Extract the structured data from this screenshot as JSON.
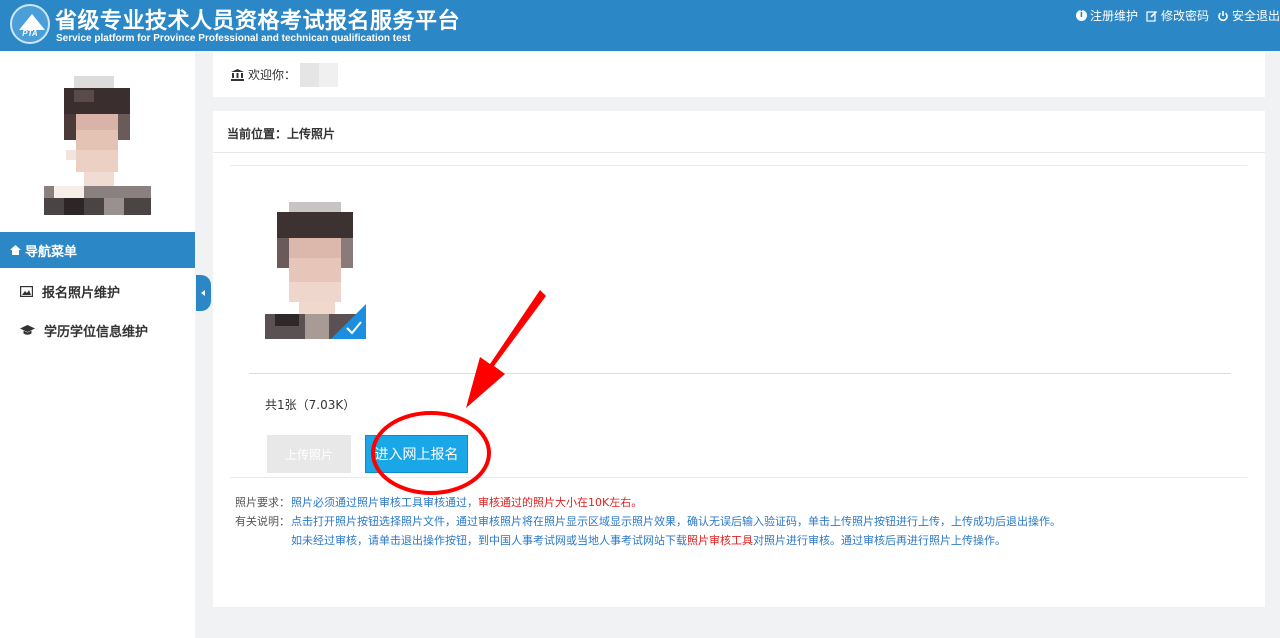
{
  "header": {
    "logo_text": "PTA",
    "title": "省级专业技术人员资格考试报名服务平台",
    "subtitle": "Service platform for Province Professional and technican qualification test",
    "links": [
      {
        "icon": "info-icon",
        "label": "注册维护"
      },
      {
        "icon": "edit-icon",
        "label": "修改密码"
      },
      {
        "icon": "power-icon",
        "label": "安全退出"
      }
    ]
  },
  "sidebar": {
    "nav_title": "导航菜单",
    "items": [
      {
        "icon": "image-icon",
        "label": "报名照片维护"
      },
      {
        "icon": "graduation-cap-icon",
        "label": "学历学位信息维护"
      }
    ]
  },
  "welcome": {
    "label": "欢迎你："
  },
  "main": {
    "breadcrumb": "当前位置：上传照片",
    "photo_count": "共1张（7.03K）",
    "upload_button": "上传照片",
    "enter_button": "进入网上报名",
    "notes": {
      "req_label": "照片要求：",
      "req_text_blue": "照片必须通过照片审核工具审核通过，",
      "req_text_red": "审核通过的照片大小在10K左右。",
      "desc_label": "有关说明：",
      "desc_line1": "点击打开照片按钮选择照片文件，通过审核照片将在照片显示区域显示照片效果，确认无误后输入验证码，单击上传照片按钮进行上传，上传成功后退出操作。",
      "desc_line2_a": "如未经过审核，请单击退出操作按钮，到中国人事考试网或当地人事考试网站下载",
      "desc_line2_link": "照片审核工具",
      "desc_line2_b": "对照片进行审核。通过审核后再进行照片上传操作。"
    }
  },
  "colors": {
    "header_bg": "#2b87c5",
    "primary_button": "#1aa7e8",
    "annotation_red": "#ff0000"
  }
}
